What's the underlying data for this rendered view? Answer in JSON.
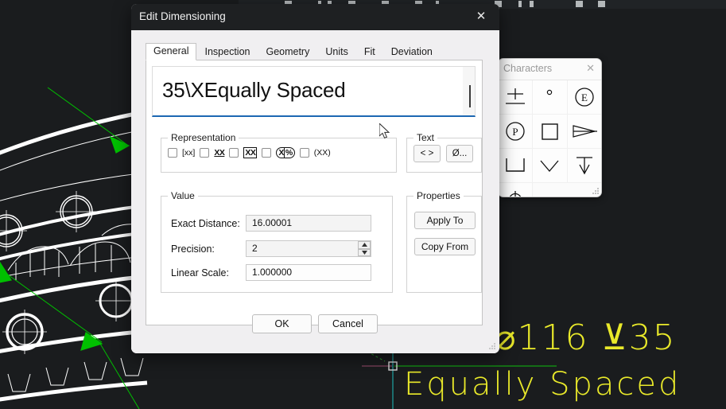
{
  "app": {
    "canvas_background": "#1a1c1e",
    "accent_color": "#1d68b3",
    "cad_annotation_color": "#e9e92a",
    "selection_color": "#00c000"
  },
  "cad": {
    "dimension_text": "⌀116 ⊻35",
    "note_text": "Equally Spaced"
  },
  "dialog": {
    "title": "Edit Dimensioning",
    "close_icon": "close-icon",
    "tabs": [
      {
        "label": "General",
        "active": true
      },
      {
        "label": "Inspection",
        "active": false
      },
      {
        "label": "Geometry",
        "active": false
      },
      {
        "label": "Units",
        "active": false
      },
      {
        "label": "Fit",
        "active": false
      },
      {
        "label": "Deviation",
        "active": false
      }
    ],
    "dimension_text_value": "35\\XEqually Spaced",
    "representation": {
      "legend": "Representation",
      "options": [
        {
          "glyph": "[xx]",
          "style": "plain",
          "checked": false
        },
        {
          "glyph": "XX",
          "style": "underline",
          "checked": false
        },
        {
          "glyph": "XX",
          "style": "boxed",
          "checked": false
        },
        {
          "glyph": "X",
          "glyph2": "%",
          "style": "pill",
          "checked": false
        },
        {
          "glyph": "(XX)",
          "style": "plain",
          "checked": false
        }
      ]
    },
    "text_group": {
      "legend": "Text",
      "buttons": [
        {
          "label": "< >",
          "name": "insert-brackets-button"
        },
        {
          "label": "Ø...",
          "name": "insert-symbol-button"
        }
      ]
    },
    "value_group": {
      "legend": "Value",
      "exact_distance_label": "Exact Distance:",
      "exact_distance_value": "16.00001",
      "precision_label": "Precision:",
      "precision_value": "2",
      "linear_scale_label": "Linear Scale:",
      "linear_scale_value": "1.000000"
    },
    "properties_group": {
      "legend": "Properties",
      "apply_to_label": "Apply To",
      "copy_from_label": "Copy From"
    },
    "footer": {
      "ok_label": "OK",
      "cancel_label": "Cancel"
    }
  },
  "characters_palette": {
    "title": "Characters",
    "close_icon": "close-icon",
    "symbols": [
      {
        "name": "plus-minus-bar-symbol"
      },
      {
        "name": "degree-symbol"
      },
      {
        "name": "circled-e-symbol"
      },
      {
        "name": "circled-p-symbol"
      },
      {
        "name": "square-symbol"
      },
      {
        "name": "taper-symbol"
      },
      {
        "name": "counterbore-symbol"
      },
      {
        "name": "countersink-symbol"
      },
      {
        "name": "depth-symbol"
      },
      {
        "name": "position-symbol"
      }
    ]
  }
}
